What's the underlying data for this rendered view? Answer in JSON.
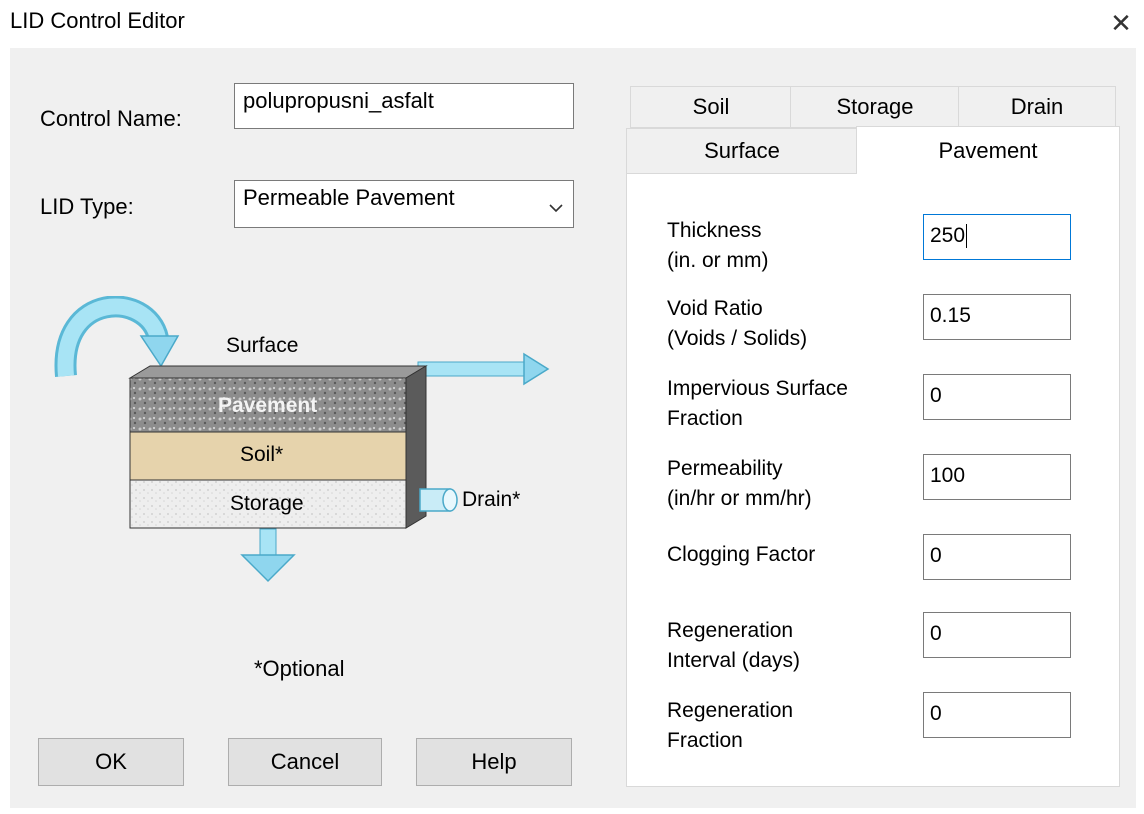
{
  "window": {
    "title": "LID Control Editor",
    "close_glyph": "✕"
  },
  "form": {
    "control_name_label": "Control Name:",
    "control_name_value": "polupropusni_asfalt",
    "lid_type_label": "LID Type:",
    "lid_type_value": "Permeable Pavement"
  },
  "diagram": {
    "surface_label": "Surface",
    "pavement_label": "Pavement",
    "soil_label": "Soil*",
    "storage_label": "Storage",
    "drain_label": "Drain*",
    "optional_note": "*Optional",
    "colors": {
      "arrow": "#7fd3ee",
      "soil": "#e6d3ac",
      "storage": "#e4e4e4",
      "pavement": "#8a8a8a"
    }
  },
  "buttons": {
    "ok": "OK",
    "cancel": "Cancel",
    "help": "Help"
  },
  "tabs": {
    "back_row": [
      "Soil",
      "Storage",
      "Drain"
    ],
    "front_row": [
      "Surface",
      "Pavement"
    ],
    "active": "Pavement"
  },
  "pavement": {
    "fields": [
      {
        "label1": "Thickness",
        "label2": "(in. or mm)",
        "value": "250"
      },
      {
        "label1": "Void Ratio",
        "label2": "(Voids / Solids)",
        "value": "0.15"
      },
      {
        "label1": "Impervious Surface",
        "label2": "Fraction",
        "value": "0"
      },
      {
        "label1": "Permeability",
        "label2": "(in/hr or mm/hr)",
        "value": "100"
      },
      {
        "label1": "Clogging Factor",
        "label2": "",
        "value": "0"
      },
      {
        "label1": "Regeneration",
        "label2": "Interval (days)",
        "value": "0"
      },
      {
        "label1": "Regeneration",
        "label2": "Fraction",
        "value": "0"
      }
    ]
  }
}
